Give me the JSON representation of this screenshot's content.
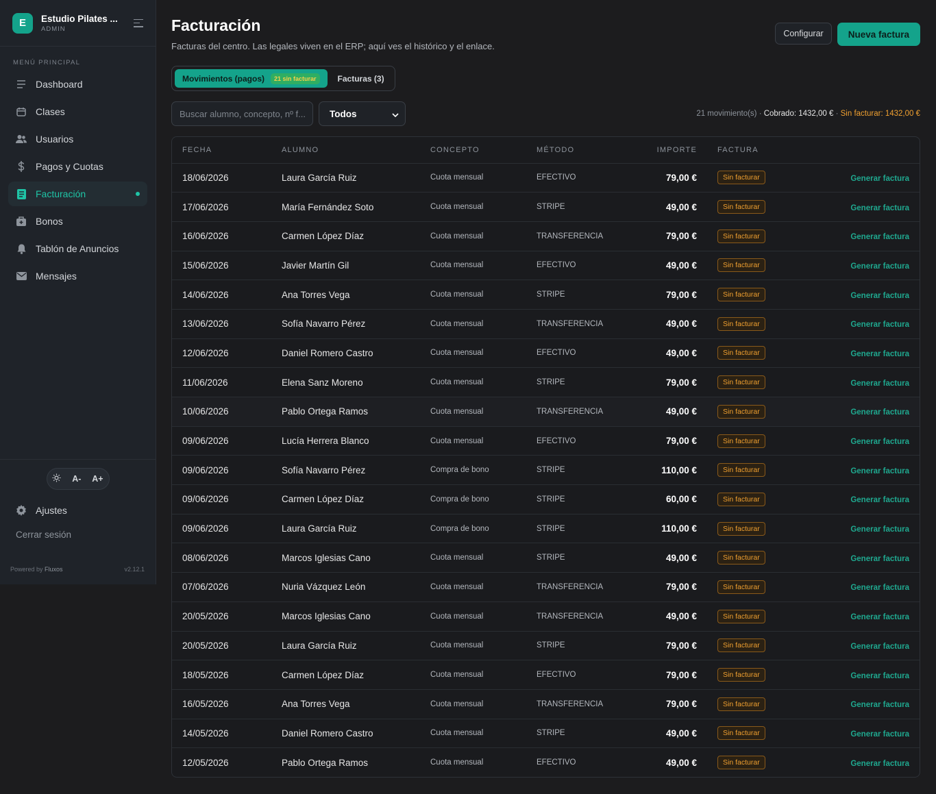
{
  "brand": {
    "logo_letter": "E",
    "name": "Estudio Pilates ...",
    "role": "ADMIN"
  },
  "sidebar": {
    "menu_label": "MENÚ PRINCIPAL",
    "items": [
      {
        "label": "Dashboard",
        "icon": "dashboard-icon"
      },
      {
        "label": "Clases",
        "icon": "calendar-icon"
      },
      {
        "label": "Usuarios",
        "icon": "users-icon"
      },
      {
        "label": "Pagos y Cuotas",
        "icon": "money-icon"
      },
      {
        "label": "Facturación",
        "icon": "invoice-icon",
        "active": true
      },
      {
        "label": "Bonos",
        "icon": "bonus-icon"
      },
      {
        "label": "Tablón de Anuncios",
        "icon": "bell-icon"
      },
      {
        "label": "Mensajes",
        "icon": "mail-icon"
      }
    ],
    "font_minus": "A-",
    "font_plus": "A+",
    "settings": "Ajustes",
    "logout": "Cerrar sesión",
    "powered_prefix": "Powered by",
    "powered_brand": "Fluxos",
    "version": "v2.12.1"
  },
  "header": {
    "title": "Facturación",
    "subtitle": "Facturas del centro. Las legales viven en el ERP; aquí ves el histórico y el enlace.",
    "configure": "Configurar",
    "new_invoice": "Nueva factura"
  },
  "tabs": {
    "movements": "Movimientos (pagos)",
    "movements_badge": "21 sin facturar",
    "invoices": "Facturas (3)"
  },
  "toolbar": {
    "search_placeholder": "Buscar alumno, concepto, nº f...",
    "filter_value": "Todos",
    "summary_count": "21 movimiento(s) ·",
    "summary_cobrado": "Cobrado: 1432,00 €",
    "summary_sep": " · ",
    "summary_pending": "Sin facturar: 1432,00 €"
  },
  "table": {
    "headers": [
      "FECHA",
      "ALUMNO",
      "CONCEPTO",
      "MÉTODO",
      "IMPORTE",
      "FACTURA"
    ],
    "badge_label": "Sin facturar",
    "action_label": "Generar factura",
    "rows": [
      {
        "date": "18/06/2026",
        "student": "Laura García Ruiz",
        "concept": "Cuota mensual",
        "method": "EFECTIVO",
        "amount": "79,00 €"
      },
      {
        "date": "17/06/2026",
        "student": "María Fernández Soto",
        "concept": "Cuota mensual",
        "method": "STRIPE",
        "amount": "49,00 €"
      },
      {
        "date": "16/06/2026",
        "student": "Carmen López Díaz",
        "concept": "Cuota mensual",
        "method": "TRANSFERENCIA",
        "amount": "79,00 €"
      },
      {
        "date": "15/06/2026",
        "student": "Javier Martín Gil",
        "concept": "Cuota mensual",
        "method": "EFECTIVO",
        "amount": "49,00 €"
      },
      {
        "date": "14/06/2026",
        "student": "Ana Torres Vega",
        "concept": "Cuota mensual",
        "method": "STRIPE",
        "amount": "79,00 €"
      },
      {
        "date": "13/06/2026",
        "student": "Sofía Navarro Pérez",
        "concept": "Cuota mensual",
        "method": "TRANSFERENCIA",
        "amount": "49,00 €"
      },
      {
        "date": "12/06/2026",
        "student": "Daniel Romero Castro",
        "concept": "Cuota mensual",
        "method": "EFECTIVO",
        "amount": "49,00 €"
      },
      {
        "date": "11/06/2026",
        "student": "Elena Sanz Moreno",
        "concept": "Cuota mensual",
        "method": "STRIPE",
        "amount": "79,00 €"
      },
      {
        "date": "10/06/2026",
        "student": "Pablo Ortega Ramos",
        "concept": "Cuota mensual",
        "method": "TRANSFERENCIA",
        "amount": "49,00 €"
      },
      {
        "date": "09/06/2026",
        "student": "Lucía Herrera Blanco",
        "concept": "Cuota mensual",
        "method": "EFECTIVO",
        "amount": "79,00 €"
      },
      {
        "date": "09/06/2026",
        "student": "Sofía Navarro Pérez",
        "concept": "Compra de bono",
        "method": "STRIPE",
        "amount": "110,00 €"
      },
      {
        "date": "09/06/2026",
        "student": "Carmen López Díaz",
        "concept": "Compra de bono",
        "method": "STRIPE",
        "amount": "60,00 €"
      },
      {
        "date": "09/06/2026",
        "student": "Laura García Ruiz",
        "concept": "Compra de bono",
        "method": "STRIPE",
        "amount": "110,00 €"
      },
      {
        "date": "08/06/2026",
        "student": "Marcos Iglesias Cano",
        "concept": "Cuota mensual",
        "method": "STRIPE",
        "amount": "49,00 €"
      },
      {
        "date": "07/06/2026",
        "student": "Nuria Vázquez León",
        "concept": "Cuota mensual",
        "method": "TRANSFERENCIA",
        "amount": "79,00 €"
      },
      {
        "date": "20/05/2026",
        "student": "Marcos Iglesias Cano",
        "concept": "Cuota mensual",
        "method": "TRANSFERENCIA",
        "amount": "49,00 €"
      },
      {
        "date": "20/05/2026",
        "student": "Laura García Ruiz",
        "concept": "Cuota mensual",
        "method": "STRIPE",
        "amount": "79,00 €"
      },
      {
        "date": "18/05/2026",
        "student": "Carmen López Díaz",
        "concept": "Cuota mensual",
        "method": "EFECTIVO",
        "amount": "79,00 €"
      },
      {
        "date": "16/05/2026",
        "student": "Ana Torres Vega",
        "concept": "Cuota mensual",
        "method": "TRANSFERENCIA",
        "amount": "79,00 €"
      },
      {
        "date": "14/05/2026",
        "student": "Daniel Romero Castro",
        "concept": "Cuota mensual",
        "method": "STRIPE",
        "amount": "49,00 €"
      },
      {
        "date": "12/05/2026",
        "student": "Pablo Ortega Ramos",
        "concept": "Cuota mensual",
        "method": "EFECTIVO",
        "amount": "49,00 €"
      }
    ]
  },
  "colors": {
    "accent": "#14a38b",
    "accent_text": "#1fc4a6",
    "warning": "#f0a030"
  }
}
